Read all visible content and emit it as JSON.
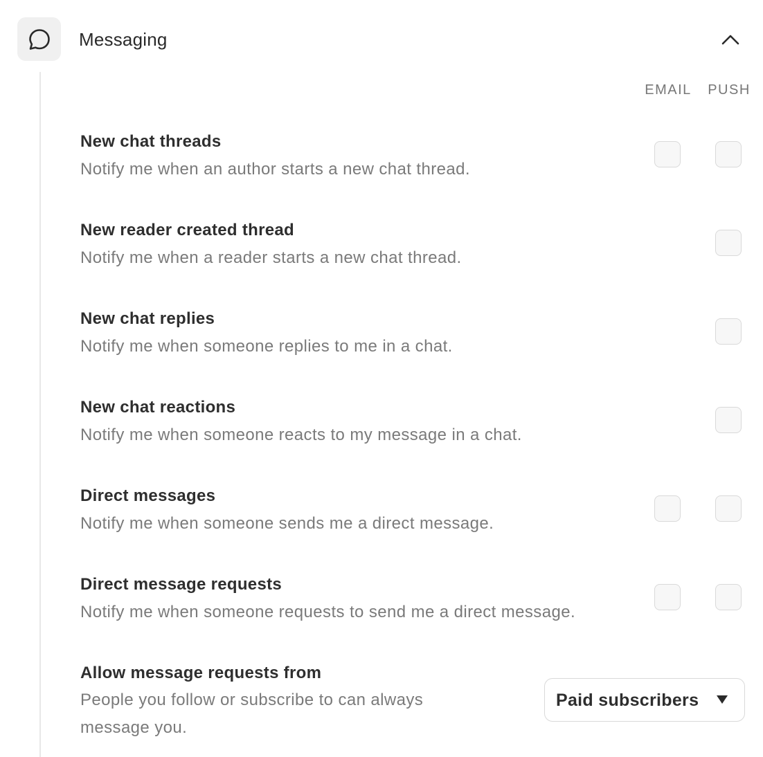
{
  "section": {
    "title": "Messaging",
    "icon": "chat-bubble-icon",
    "collapse_icon": "chevron-up-icon"
  },
  "columns": {
    "email": "EMAIL",
    "push": "PUSH"
  },
  "rows": [
    {
      "title": "New chat threads",
      "description": "Notify me when an author starts a new chat thread.",
      "email_checked": false,
      "push_checked": false
    },
    {
      "title": "New reader created thread",
      "description": "Notify me when a reader starts a new chat thread.",
      "push_checked": false
    },
    {
      "title": "New chat replies",
      "description": "Notify me when someone replies to me in a chat.",
      "push_checked": false
    },
    {
      "title": "New chat reactions",
      "description": "Notify me when someone reacts to my message in a chat.",
      "push_checked": false
    },
    {
      "title": "Direct messages",
      "description": "Notify me when someone sends me a direct message.",
      "email_checked": false,
      "push_checked": false
    },
    {
      "title": "Direct message requests",
      "description": "Notify me when someone requests to send me a direct message.",
      "email_checked": false,
      "push_checked": false
    }
  ],
  "message_requests": {
    "title": "Allow message requests from",
    "description": "People you follow or subscribe to can always message you.",
    "selected": "Paid subscribers"
  },
  "colors": {
    "icon_box_bg": "#f0f0f0",
    "title_text": "#2e2e2e",
    "muted_text": "#7a7a7a",
    "border": "#d9d9d9"
  }
}
